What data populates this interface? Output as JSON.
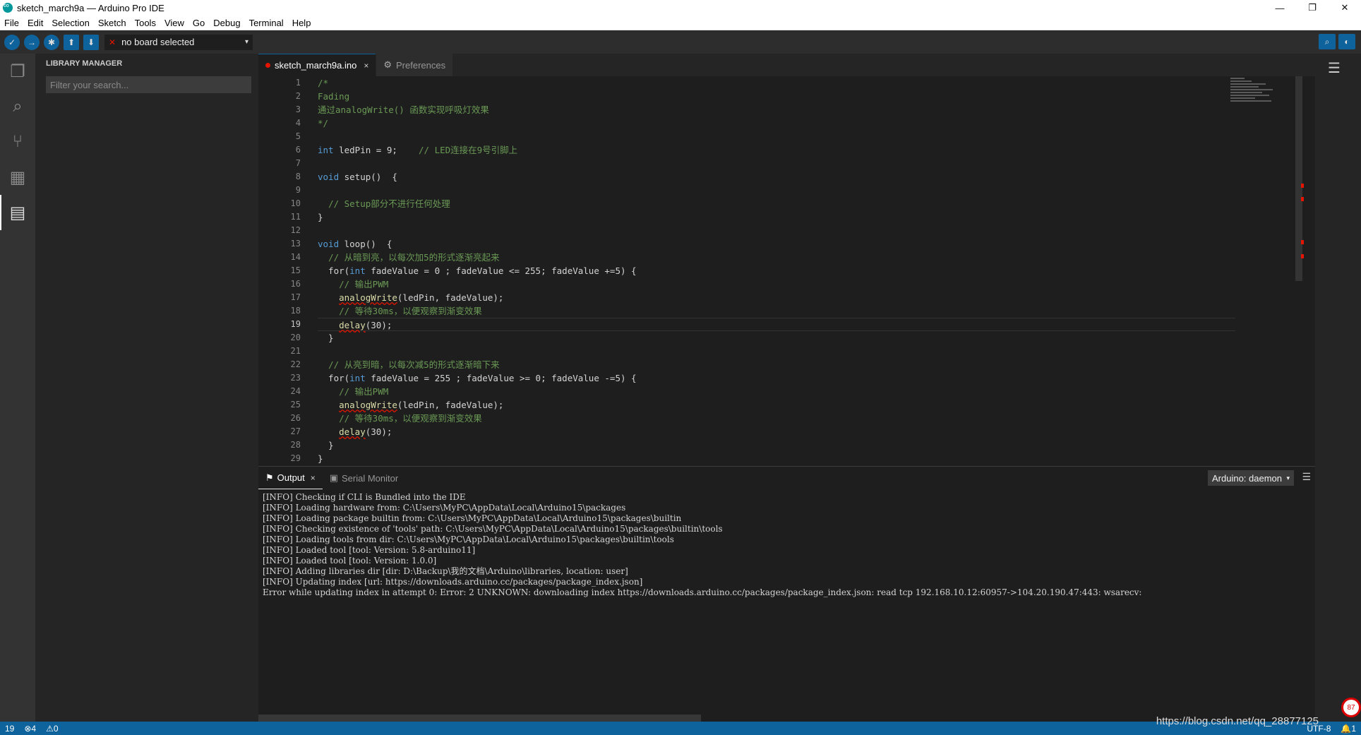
{
  "window": {
    "title": "sketch_march9a — Arduino Pro IDE",
    "controls": [
      "—",
      "❐",
      "✕"
    ]
  },
  "menu": [
    "File",
    "Edit",
    "Selection",
    "Sketch",
    "Tools",
    "View",
    "Go",
    "Debug",
    "Terminal",
    "Help"
  ],
  "toolbar": {
    "verify_icon": "✓",
    "upload_icon": "→",
    "debug_icon": "✱",
    "new_icon": "⬆",
    "open_icon": "⬇",
    "board_status": "✕",
    "board_label": "no board selected",
    "caret": "▾"
  },
  "sidebar": {
    "header": "LIBRARY MANAGER",
    "search_placeholder": "Filter your search..."
  },
  "tabs": [
    {
      "label": "sketch_march9a.ino",
      "close": "×"
    },
    {
      "label": "Preferences",
      "icon": "⚙"
    }
  ],
  "editor": {
    "lines": [
      {
        "n": "1",
        "segs": [
          {
            "t": "/*",
            "c": "cmt"
          }
        ]
      },
      {
        "n": "2",
        "segs": [
          {
            "t": "Fading",
            "c": "cmt"
          }
        ]
      },
      {
        "n": "3",
        "segs": [
          {
            "t": "通过analogWrite() 函数实现呼吸灯效果",
            "c": "cmt"
          }
        ]
      },
      {
        "n": "4",
        "segs": [
          {
            "t": "*/",
            "c": "cmt"
          }
        ]
      },
      {
        "n": "5",
        "segs": []
      },
      {
        "n": "6",
        "segs": [
          {
            "t": "int",
            "c": "kw"
          },
          {
            "t": " ledPin = 9;    ",
            "c": ""
          },
          {
            "t": "// LED连接在9号引脚上",
            "c": "cmt"
          }
        ]
      },
      {
        "n": "7",
        "segs": []
      },
      {
        "n": "8",
        "segs": [
          {
            "t": "void",
            "c": "kw"
          },
          {
            "t": " setup()  {",
            "c": ""
          }
        ]
      },
      {
        "n": "9",
        "segs": []
      },
      {
        "n": "10",
        "segs": [
          {
            "t": "  ",
            "c": ""
          },
          {
            "t": "// Setup部分不进行任何处理",
            "c": "cmt"
          }
        ]
      },
      {
        "n": "11",
        "segs": [
          {
            "t": "}",
            "c": ""
          }
        ]
      },
      {
        "n": "12",
        "segs": []
      },
      {
        "n": "13",
        "segs": [
          {
            "t": "void",
            "c": "kw"
          },
          {
            "t": " loop()  {",
            "c": ""
          }
        ]
      },
      {
        "n": "14",
        "segs": [
          {
            "t": "  ",
            "c": ""
          },
          {
            "t": "// 从暗到亮，以每次加5的形式逐渐亮起来",
            "c": "cmt"
          }
        ]
      },
      {
        "n": "15",
        "segs": [
          {
            "t": "  for(",
            "c": ""
          },
          {
            "t": "int",
            "c": "kw"
          },
          {
            "t": " fadeValue = 0 ; fadeValue <= 255; fadeValue +=5) {",
            "c": ""
          }
        ]
      },
      {
        "n": "16",
        "segs": [
          {
            "t": "    ",
            "c": ""
          },
          {
            "t": "// 输出PWM",
            "c": "cmt"
          }
        ]
      },
      {
        "n": "17",
        "segs": [
          {
            "t": "    ",
            "c": ""
          },
          {
            "t": "analogWrite",
            "c": "fn err"
          },
          {
            "t": "(ledPin, fadeValue);",
            "c": ""
          }
        ]
      },
      {
        "n": "18",
        "segs": [
          {
            "t": "    ",
            "c": ""
          },
          {
            "t": "// 等待30ms，以便观察到渐变效果",
            "c": "cmt"
          }
        ]
      },
      {
        "n": "19",
        "segs": [
          {
            "t": "    ",
            "c": ""
          },
          {
            "t": "delay",
            "c": "fn err"
          },
          {
            "t": "(30);",
            "c": ""
          }
        ],
        "current": true
      },
      {
        "n": "20",
        "segs": [
          {
            "t": "  }",
            "c": ""
          }
        ]
      },
      {
        "n": "21",
        "segs": []
      },
      {
        "n": "22",
        "segs": [
          {
            "t": "  ",
            "c": ""
          },
          {
            "t": "// 从亮到暗，以每次减5的形式逐渐暗下来",
            "c": "cmt"
          }
        ]
      },
      {
        "n": "23",
        "segs": [
          {
            "t": "  for(",
            "c": ""
          },
          {
            "t": "int",
            "c": "kw"
          },
          {
            "t": " fadeValue = 255 ; fadeValue >= 0; fadeValue -=5) {",
            "c": ""
          }
        ]
      },
      {
        "n": "24",
        "segs": [
          {
            "t": "    ",
            "c": ""
          },
          {
            "t": "// 输出PWM",
            "c": "cmt"
          }
        ]
      },
      {
        "n": "25",
        "segs": [
          {
            "t": "    ",
            "c": ""
          },
          {
            "t": "analogWrite",
            "c": "fn err"
          },
          {
            "t": "(ledPin, fadeValue);",
            "c": ""
          }
        ]
      },
      {
        "n": "26",
        "segs": [
          {
            "t": "    ",
            "c": ""
          },
          {
            "t": "// 等待30ms，以便观察到渐变效果",
            "c": "cmt"
          }
        ]
      },
      {
        "n": "27",
        "segs": [
          {
            "t": "    ",
            "c": ""
          },
          {
            "t": "delay",
            "c": "fn err"
          },
          {
            "t": "(30);",
            "c": ""
          }
        ]
      },
      {
        "n": "28",
        "segs": [
          {
            "t": "  }",
            "c": ""
          }
        ]
      },
      {
        "n": "29",
        "segs": [
          {
            "t": "}",
            "c": ""
          }
        ]
      }
    ]
  },
  "panel": {
    "tabs": [
      {
        "label": "Output",
        "icon": "⚑",
        "close": "×"
      },
      {
        "label": "Serial Monitor",
        "icon": "▣"
      }
    ],
    "channel": "Arduino: daemon",
    "channel_caret": "▾",
    "menu_icon": "☰",
    "output_lines": [
      "[INFO] Checking if CLI is Bundled into the IDE",
      "[INFO] Loading hardware from: C:\\Users\\MyPC\\AppData\\Local\\Arduino15\\packages",
      "[INFO] Loading package builtin from: C:\\Users\\MyPC\\AppData\\Local\\Arduino15\\packages\\builtin",
      "[INFO] Checking existence of 'tools' path: C:\\Users\\MyPC\\AppData\\Local\\Arduino15\\packages\\builtin\\tools",
      "[INFO] Loading tools from dir: C:\\Users\\MyPC\\AppData\\Local\\Arduino15\\packages\\builtin\\tools",
      "[INFO] Loaded tool [tool: Version: 5.8-arduino11]",
      "[INFO] Loaded tool [tool: Version: 1.0.0]",
      "[INFO] Adding libraries dir [dir: D:\\Backup\\我的文档\\Arduino\\libraries, location: user]",
      "[INFO] Updating index [url: https://downloads.arduino.cc/packages/package_index.json]",
      "Error while updating index in attempt 0: Error: 2 UNKNOWN: downloading index https://downloads.arduino.cc/packages/package_index.json: read tcp 192.168.10.12:60957->104.20.190.47:443: wsarecv:"
    ]
  },
  "status": {
    "line": "19",
    "errors": "⊗4",
    "warnings": "⚠0",
    "encoding": "UTF-8",
    "notifications": "🔔1"
  },
  "watermark": "https://blog.csdn.net/qq_28877125",
  "badge": "87",
  "colors": {
    "accent": "#0e639c",
    "error": "#e51400",
    "comment": "#6a9955",
    "keyword": "#569cd6"
  }
}
